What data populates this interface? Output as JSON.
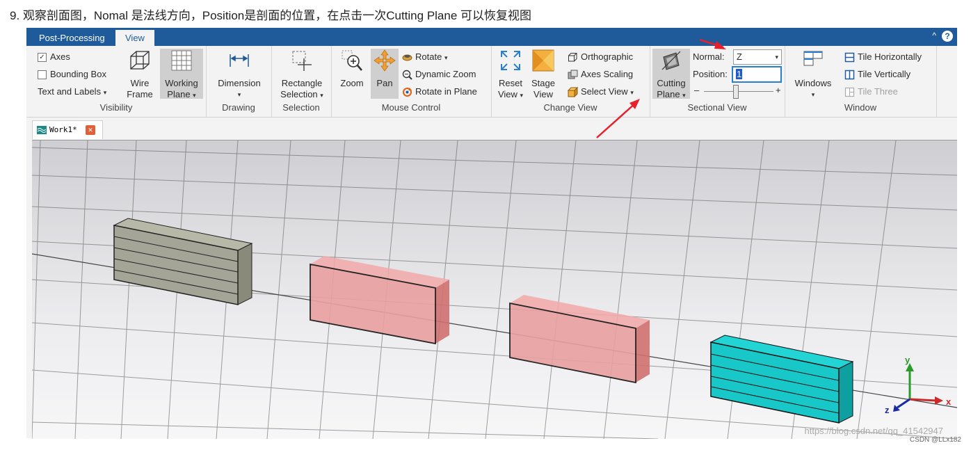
{
  "caption": "9. 观察剖面图，Nomal 是法线方向，Position是剖面的位置，在点击一次Cutting Plane 可以恢复视图",
  "ribbon_tabs": [
    "Post-Processing",
    "View"
  ],
  "ribbon_controls": {
    "minimize": "^",
    "help": "?"
  },
  "groups": {
    "visibility": {
      "label": "Visibility",
      "axes": "Axes",
      "bounding_box": "Bounding Box",
      "text_and_labels": "Text and Labels",
      "wire_frame_1": "Wire",
      "wire_frame_2": "Frame",
      "working_plane_1": "Working",
      "working_plane_2": "Plane"
    },
    "drawing": {
      "label": "Drawing",
      "dimension": "Dimension"
    },
    "selection": {
      "label": "Selection",
      "rect_1": "Rectangle",
      "rect_2": "Selection"
    },
    "mouse_control": {
      "label": "Mouse Control",
      "zoom": "Zoom",
      "pan": "Pan",
      "rotate": "Rotate",
      "dynamic_zoom": "Dynamic Zoom",
      "rotate_in_plane": "Rotate in Plane"
    },
    "change_view": {
      "label": "Change View",
      "reset_1": "Reset",
      "reset_2": "View",
      "stage_1": "Stage",
      "stage_2": "View",
      "orthographic": "Orthographic",
      "axes_scaling": "Axes Scaling",
      "select_view": "Select View"
    },
    "sectional_view": {
      "label": "Sectional View",
      "cutting_1": "Cutting",
      "cutting_2": "Plane",
      "normal_label": "Normal:",
      "normal_value": "Z",
      "position_label": "Position:",
      "position_value": "1",
      "slider_minus": "–",
      "slider_plus": "+",
      "slider_level": 0.45
    },
    "window": {
      "label": "Window",
      "windows": "Windows",
      "tile_horizontally": "Tile Horizontally",
      "tile_vertically": "Tile Vertically",
      "tile_three": "Tile Three"
    }
  },
  "doc_tab": "Work1*",
  "axis_triad": {
    "y": "y",
    "z": "z",
    "x": "x"
  },
  "watermark": "https://blog.csdn.net/qq_41542947",
  "csdn_credit": "CSDN @LLx182",
  "colors": {
    "ribbon_blue": "#1f5b9a",
    "arrow_red": "#e8202a",
    "box_gray": "#9a9a8a",
    "box_pink": "#e89a9a",
    "box_cyan": "#18c8c8"
  }
}
